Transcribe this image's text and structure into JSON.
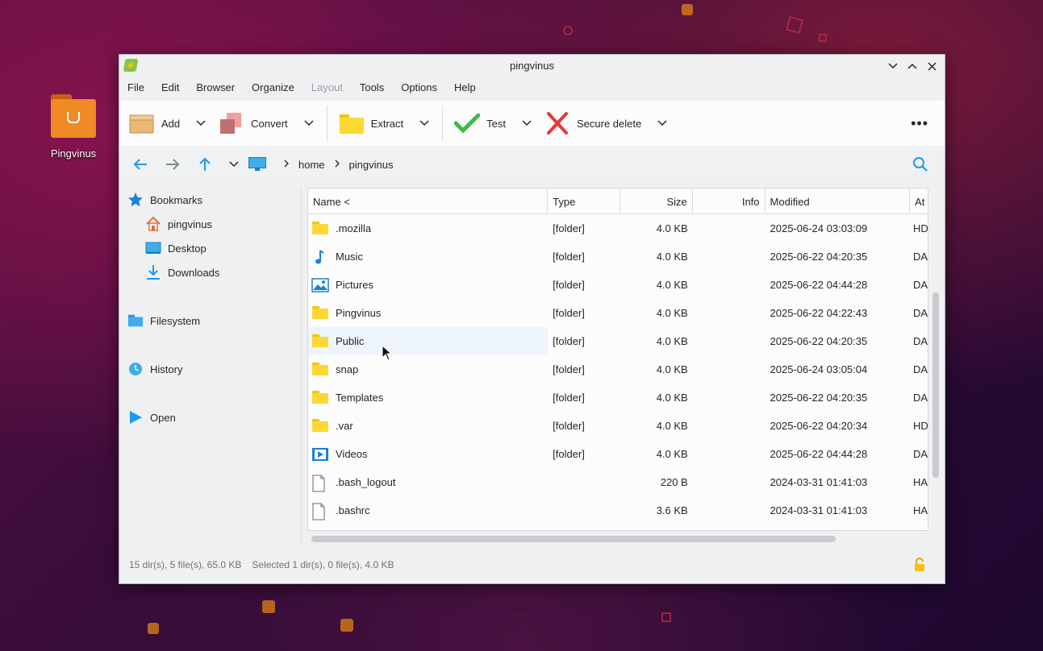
{
  "desktop": {
    "icon_label": "Pingvinus"
  },
  "window": {
    "title": "pingvinus"
  },
  "menu": [
    "File",
    "Edit",
    "Browser",
    "Organize",
    "Layout",
    "Tools",
    "Options",
    "Help"
  ],
  "toolbar": {
    "add": "Add",
    "convert": "Convert",
    "extract": "Extract",
    "test": "Test",
    "secure_delete": "Secure delete",
    "more": "•••"
  },
  "breadcrumb": [
    "home",
    "pingvinus"
  ],
  "sidebar": {
    "bookmarks": "Bookmarks",
    "pingvinus": "pingvinus",
    "desktop": "Desktop",
    "downloads": "Downloads",
    "filesystem": "Filesystem",
    "history": "History",
    "open": "Open"
  },
  "columns": {
    "name": "Name <",
    "type": "Type",
    "size": "Size",
    "info": "Info",
    "modified": "Modified",
    "attr": "At"
  },
  "files": [
    {
      "name": ".mozilla",
      "type": "[folder]",
      "size": "4.0 KB",
      "modified": "2025-06-24 03:03:09",
      "attr": "HD",
      "icon": "folder-icon"
    },
    {
      "name": "Music",
      "type": "[folder]",
      "size": "4.0 KB",
      "modified": "2025-06-22 04:20:35",
      "attr": "DA",
      "icon": "music-icon"
    },
    {
      "name": "Pictures",
      "type": "[folder]",
      "size": "4.0 KB",
      "modified": "2025-06-22 04:44:28",
      "attr": "DA",
      "icon": "pictures-icon"
    },
    {
      "name": "Pingvinus",
      "type": "[folder]",
      "size": "4.0 KB",
      "modified": "2025-06-22 04:22:43",
      "attr": "DA",
      "icon": "folder-icon"
    },
    {
      "name": "Public",
      "type": "[folder]",
      "size": "4.0 KB",
      "modified": "2025-06-22 04:20:35",
      "attr": "DA",
      "icon": "folder-icon"
    },
    {
      "name": "snap",
      "type": "[folder]",
      "size": "4.0 KB",
      "modified": "2025-06-24 03:05:04",
      "attr": "DA",
      "icon": "folder-icon"
    },
    {
      "name": "Templates",
      "type": "[folder]",
      "size": "4.0 KB",
      "modified": "2025-06-22 04:20:35",
      "attr": "DA",
      "icon": "folder-icon"
    },
    {
      "name": ".var",
      "type": "[folder]",
      "size": "4.0 KB",
      "modified": "2025-06-22 04:20:34",
      "attr": "HD",
      "icon": "folder-icon"
    },
    {
      "name": "Videos",
      "type": "[folder]",
      "size": "4.0 KB",
      "modified": "2025-06-22 04:44:28",
      "attr": "DA",
      "icon": "videos-icon"
    },
    {
      "name": ".bash_logout",
      "type": "",
      "size": "220 B",
      "modified": "2024-03-31 01:41:03",
      "attr": "HA",
      "icon": "file-icon"
    },
    {
      "name": ".bashrc",
      "type": "",
      "size": "3.6 KB",
      "modified": "2024-03-31 01:41:03",
      "attr": "HA",
      "icon": "file-icon"
    }
  ],
  "status": {
    "summary": "15 dir(s), 5 file(s), 65.0 KB",
    "selection": "Selected 1 dir(s), 0 file(s), 4.0 KB"
  },
  "colors": {
    "accent": "#1d99f3",
    "folder": "#fdd835",
    "desktop_folder": "#f08a24"
  }
}
